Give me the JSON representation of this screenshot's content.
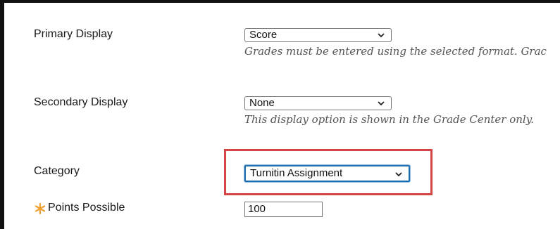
{
  "fields": {
    "primary_display": {
      "label": "Primary Display",
      "selected": "Score",
      "hint": "Grades must be entered using the selected format. Grac"
    },
    "secondary_display": {
      "label": "Secondary Display",
      "selected": "None",
      "hint": "This display option is shown in the Grade Center only."
    },
    "category": {
      "label": "Category",
      "selected": "Turnitin Assignment"
    },
    "points_possible": {
      "label": "Points Possible",
      "value": "100",
      "required_icon": "asterisk-icon"
    }
  },
  "colors": {
    "highlight_box": "#d64545",
    "focus_border": "#1f6fb5",
    "required_asterisk": "#f0a030"
  }
}
